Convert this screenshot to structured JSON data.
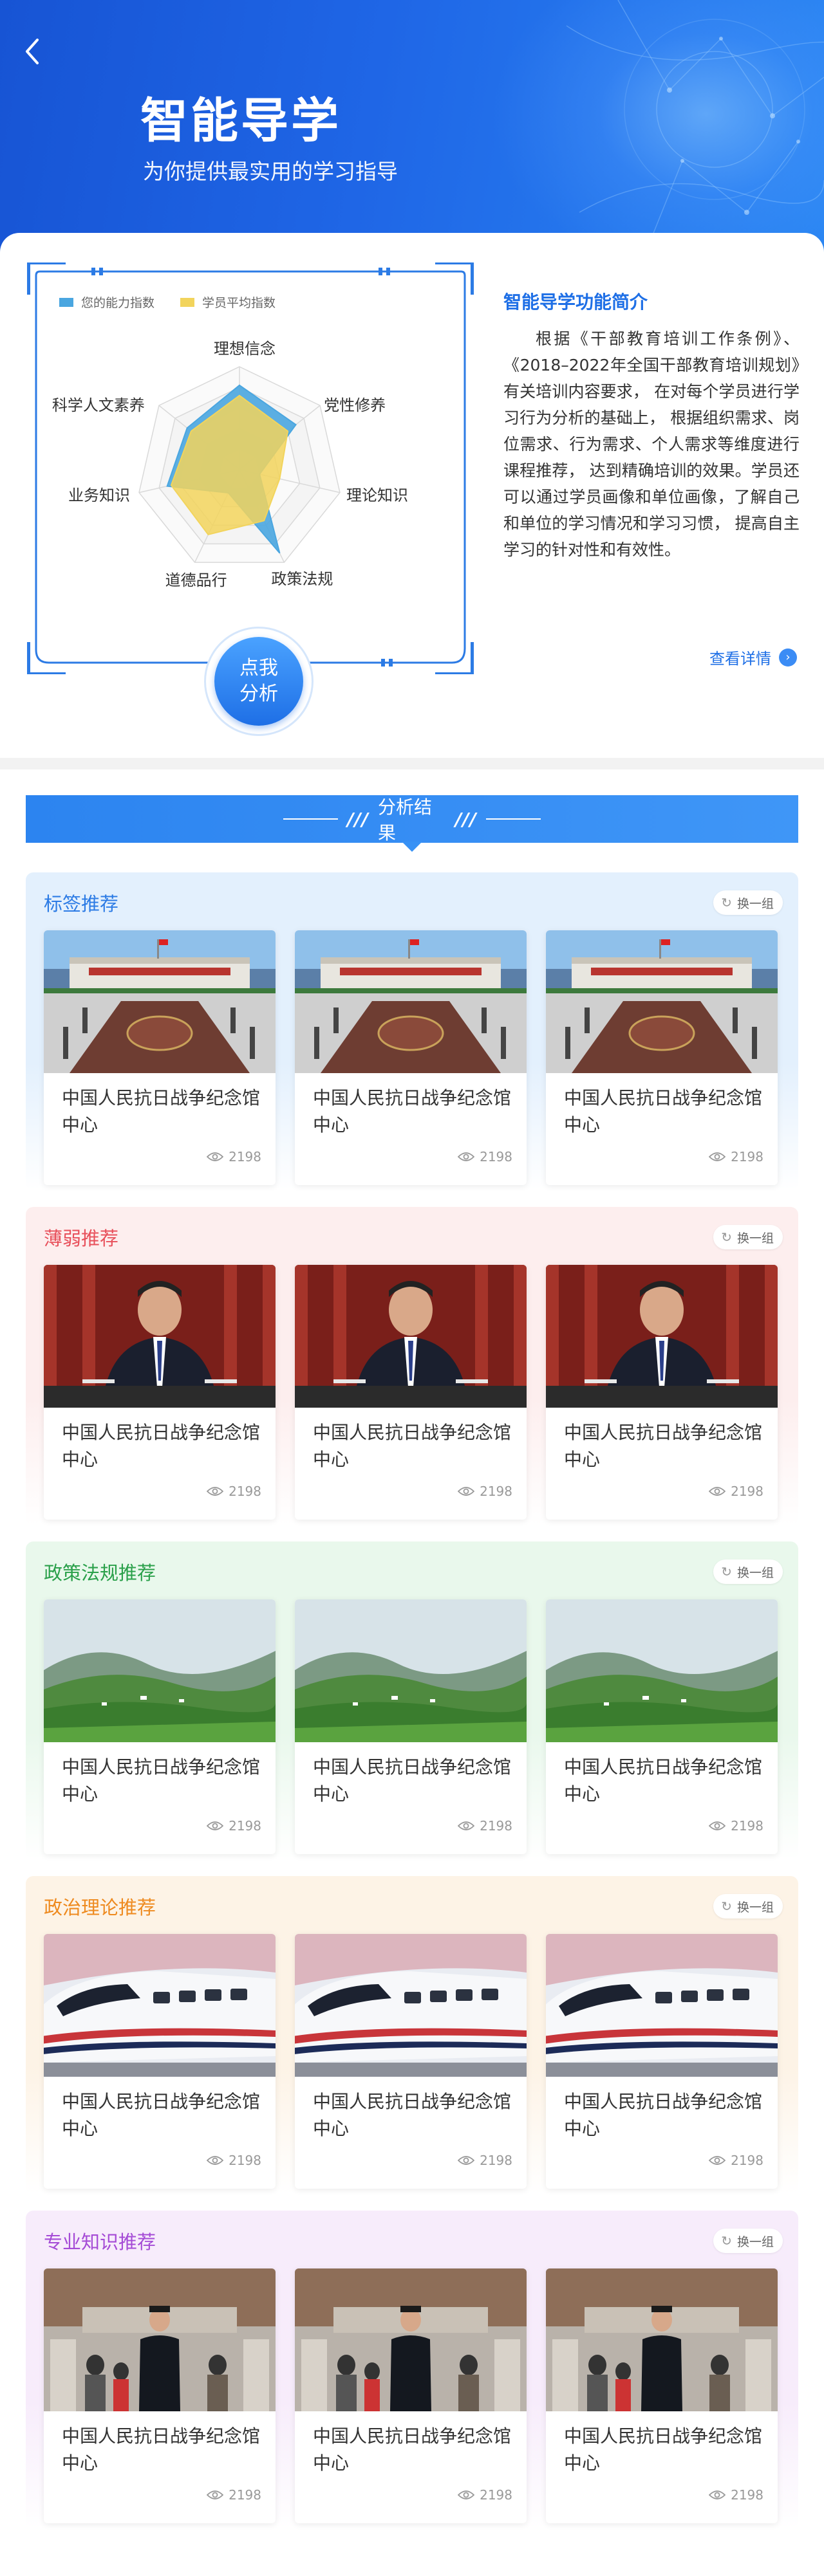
{
  "header": {
    "title": "智能导学",
    "subtitle": "为你提供最实用的学习指导"
  },
  "intro": {
    "legend": {
      "ability": "您的能力指数",
      "average": "学员平均指数"
    },
    "radar": {
      "axes": [
        "理想信念",
        "党性修养",
        "理论知识",
        "政策法规",
        "道德品行",
        "业务知识",
        "科学人文素养"
      ],
      "ability": [
        0.82,
        0.7,
        0.2,
        0.9,
        0.25,
        0.72,
        0.65
      ],
      "average": [
        0.72,
        0.6,
        0.4,
        0.55,
        0.7,
        0.68,
        0.6
      ],
      "colors": {
        "ability": "#4aa6e0",
        "average": "#f2d45c"
      }
    },
    "analyze_button": [
      "点我",
      "分析"
    ],
    "title": "智能导学功能简介",
    "text": "根据《干部教育培训工作条例》、《2018–2022年全国干部教育培训规划》有关培训内容要求， 在对每个学员进行学习行为分析的基础上， 根据组织需求、岗位需求、行为需求、个人需求等维度进行课程推荐， 达到精确培训的效果。学员还可以通过学员画像和单位画像，了解自己和单位的学习情况和学习习惯， 提高自主学习的针对性和有效性。",
    "link": "查看详情"
  },
  "results": {
    "title": "分析结果",
    "swap_label": "换一组",
    "sections": [
      {
        "title": "标签推荐",
        "color": "#2c7be5",
        "bg": "#e3f0fd",
        "image": "building",
        "cards": [
          {
            "title": "中国人民抗日战争纪念馆中心",
            "views": "2198"
          },
          {
            "title": "中国人民抗日战争纪念馆中心",
            "views": "2198"
          },
          {
            "title": "中国人民抗日战争纪念馆中心",
            "views": "2198"
          }
        ]
      },
      {
        "title": "薄弱推荐",
        "color": "#e8505b",
        "bg": "#fdeeee",
        "image": "speaker",
        "cards": [
          {
            "title": "中国人民抗日战争纪念馆中心",
            "views": "2198"
          },
          {
            "title": "中国人民抗日战争纪念馆中心",
            "views": "2198"
          },
          {
            "title": "中国人民抗日战争纪念馆中心",
            "views": "2198"
          }
        ]
      },
      {
        "title": "政策法规推荐",
        "color": "#2aa04a",
        "bg": "#e9f8ec",
        "image": "landscape",
        "cards": [
          {
            "title": "中国人民抗日战争纪念馆中心",
            "views": "2198"
          },
          {
            "title": "中国人民抗日战争纪念馆中心",
            "views": "2198"
          },
          {
            "title": "中国人民抗日战争纪念馆中心",
            "views": "2198"
          }
        ]
      },
      {
        "title": "政治理论推荐",
        "color": "#ee8a1f",
        "bg": "#fdf3e6",
        "image": "train",
        "cards": [
          {
            "title": "中国人民抗日战争纪念馆中心",
            "views": "2198"
          },
          {
            "title": "中国人民抗日战争纪念馆中心",
            "views": "2198"
          },
          {
            "title": "中国人民抗日战争纪念馆中心",
            "views": "2198"
          }
        ]
      },
      {
        "title": "专业知识推荐",
        "color": "#a54bd6",
        "bg": "#f7ecfb",
        "image": "officer",
        "cards": [
          {
            "title": "中国人民抗日战争纪念馆中心",
            "views": "2198"
          },
          {
            "title": "中国人民抗日战争纪念馆中心",
            "views": "2198"
          },
          {
            "title": "中国人民抗日战争纪念馆中心",
            "views": "2198"
          }
        ]
      }
    ]
  }
}
